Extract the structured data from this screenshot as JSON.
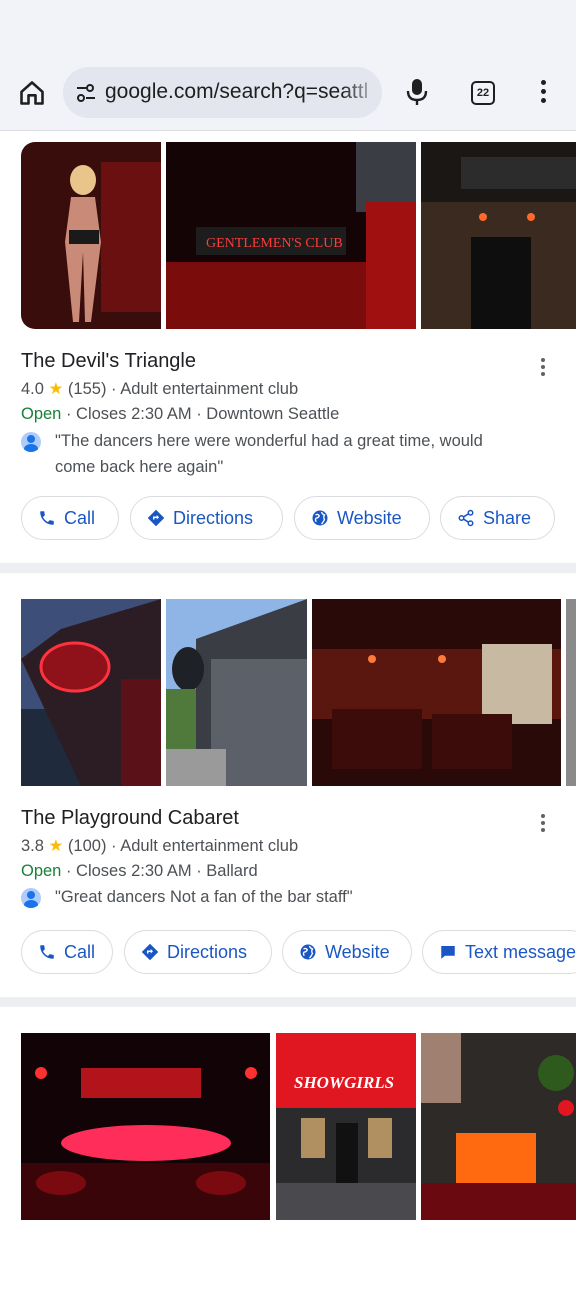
{
  "browser": {
    "url_text": "google.com/search?q=seattl",
    "tab_count": "22",
    "icons": [
      "home-icon",
      "site-settings-icon",
      "mic-icon",
      "tab-switcher-icon",
      "menu-icon"
    ]
  },
  "results": [
    {
      "name": "The Devil's Triangle",
      "rating": "4.0",
      "reviews": "(155)",
      "category": "Adult entertainment club",
      "status": "Open",
      "closes": "Closes 2:30 AM",
      "area": "Downtown Seattle",
      "review_line1": "\"The dancers here were wonderful had a great time, would",
      "review_line2": "come back here again\"",
      "actions": [
        "Call",
        "Directions",
        "Website",
        "Share"
      ]
    },
    {
      "name": "The Playground Cabaret",
      "rating": "3.8",
      "reviews": "(100)",
      "category": "Adult entertainment club",
      "status": "Open",
      "closes": "Closes 2:30 AM",
      "area": "Ballard",
      "review_line1": "\"Great dancers Not a fan of the bar staff\"",
      "actions": [
        "Call",
        "Directions",
        "Website",
        "Text message"
      ]
    },
    {
      "sign_text": "SHOWGIRLS"
    }
  ],
  "sep": " · ",
  "star": "★",
  "colors": {
    "accent": "#1a57c4",
    "open": "#188038",
    "star": "#fbbc04",
    "sign_text": "GENTLEMEN'S CLUB"
  }
}
